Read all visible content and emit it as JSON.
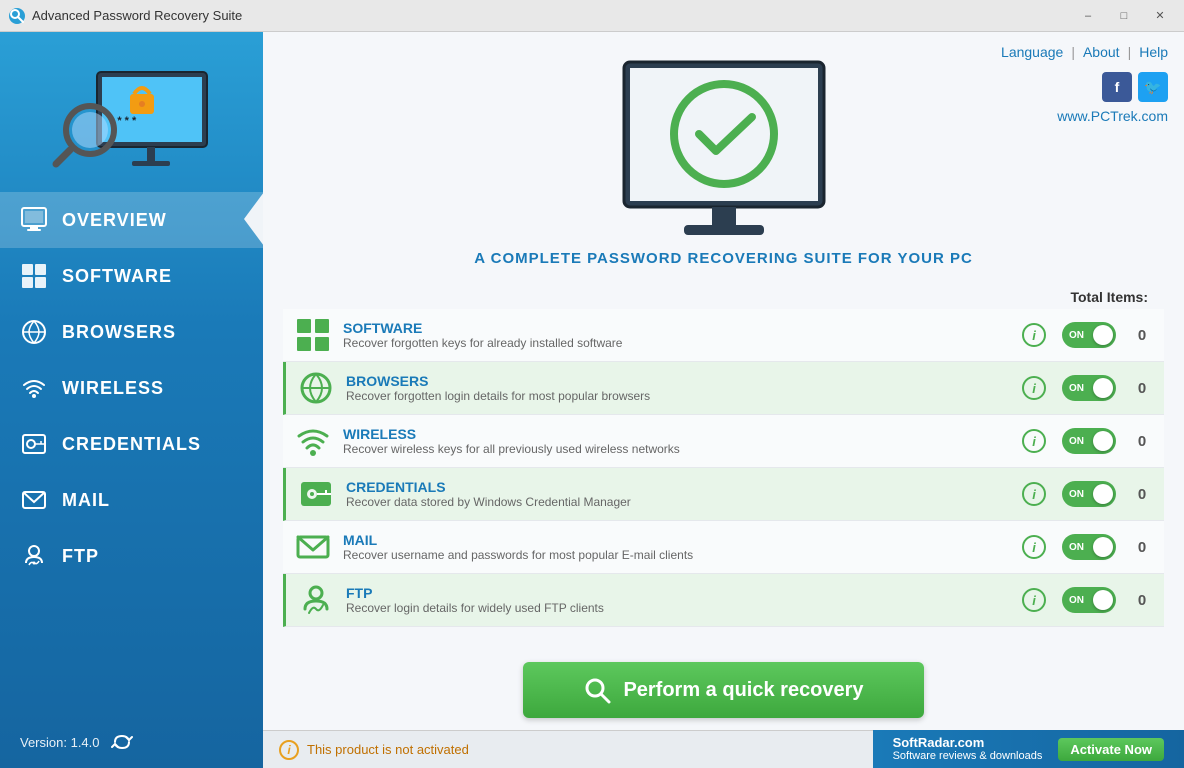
{
  "titleBar": {
    "appName": "Advanced Password Recovery Suite",
    "minimize": "–",
    "maximize": "□",
    "close": "✕"
  },
  "topLinks": {
    "language": "Language",
    "about": "About",
    "help": "Help",
    "website": "www.PCTrek.com"
  },
  "sidebar": {
    "items": [
      {
        "id": "overview",
        "label": "OVERVIEW",
        "active": true
      },
      {
        "id": "software",
        "label": "SOFTWARE",
        "active": false
      },
      {
        "id": "browsers",
        "label": "BROWSERS",
        "active": false
      },
      {
        "id": "wireless",
        "label": "WIRELESS",
        "active": false
      },
      {
        "id": "credentials",
        "label": "CREDENTIALS",
        "active": false
      },
      {
        "id": "mail",
        "label": "MAIL",
        "active": false
      },
      {
        "id": "ftp",
        "label": "FTP",
        "active": false
      }
    ],
    "version": "Version: 1.4.0"
  },
  "hero": {
    "tagline": "A COMPLETE PASSWORD RECOVERING SUITE FOR YOUR PC"
  },
  "itemsTable": {
    "totalLabel": "Total Items:",
    "items": [
      {
        "id": "software",
        "name": "SOFTWARE",
        "desc": "Recover forgotten keys for already installed software",
        "toggle": "ON",
        "count": "0"
      },
      {
        "id": "browsers",
        "name": "BROWSERS",
        "desc": "Recover forgotten login details for most popular browsers",
        "toggle": "ON",
        "count": "0"
      },
      {
        "id": "wireless",
        "name": "WIRELESS",
        "desc": "Recover wireless keys for all previously used wireless networks",
        "toggle": "ON",
        "count": "0"
      },
      {
        "id": "credentials",
        "name": "CREDENTIALS",
        "desc": "Recover data stored by Windows Credential Manager",
        "toggle": "ON",
        "count": "0",
        "highlighted": true
      },
      {
        "id": "mail",
        "name": "MAIL",
        "desc": "Recover username and passwords for most popular E-mail clients",
        "toggle": "ON",
        "count": "0"
      },
      {
        "id": "ftp",
        "name": "FTP",
        "desc": "Recover login details for widely used FTP clients",
        "toggle": "ON",
        "count": "0"
      }
    ]
  },
  "recoveryBtn": {
    "label": "Perform a quick recovery"
  },
  "statusBar": {
    "message": "This product is not activated"
  },
  "softRadar": {
    "line1": "SoftRadar.com",
    "line2": "Software reviews & downloads",
    "activateBtn": "Activate Now"
  }
}
